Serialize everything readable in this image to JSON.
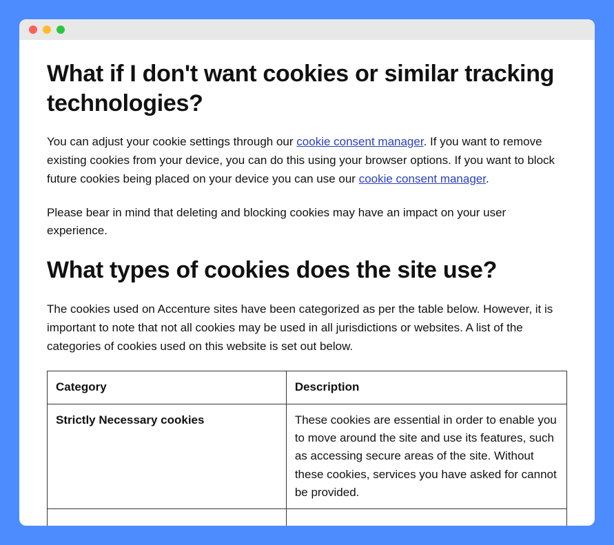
{
  "section1": {
    "heading": "What if I don't want cookies or similar tracking technologies?",
    "p1_before": "You can adjust your cookie settings through our ",
    "p1_link1": "cookie consent manager",
    "p1_mid": ". If you want to remove existing cookies from your device, you can do this using your browser options. If you want to block future cookies being placed on your device you can use our ",
    "p1_link2": "cookie consent manager",
    "p1_after": ".",
    "p2": "Please bear in mind that deleting and blocking cookies may have an impact on your user experience."
  },
  "section2": {
    "heading": "What types of cookies does the site use?",
    "p1": "The cookies used on Accenture sites have been categorized as per the table below. However, it is important to note that not all cookies may be used in all jurisdictions or websites. A list of the categories of cookies used on this website is set out below."
  },
  "table": {
    "headers": [
      "Category",
      "Description"
    ],
    "rows": [
      {
        "category": "Strictly Necessary cookies",
        "description": "These cookies are essential in order to enable you to move around the site and use its features, such as accessing secure areas of the site. Without these cookies, services you have asked for cannot be provided."
      }
    ]
  }
}
